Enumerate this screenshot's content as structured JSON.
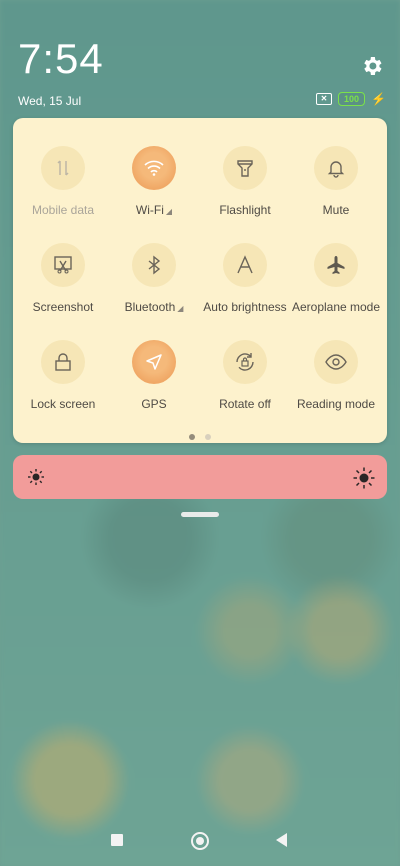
{
  "status": {
    "time": "7:54",
    "date": "Wed, 15 Jul",
    "battery": "100",
    "sim_icon_label": "✕"
  },
  "tiles": [
    {
      "label": "Mobile data",
      "icon": "mobile-data-icon",
      "active": false,
      "disabled": true
    },
    {
      "label": "Wi-Fi",
      "icon": "wifi-icon",
      "active": true,
      "expandable": true
    },
    {
      "label": "Flashlight",
      "icon": "flashlight-icon",
      "active": false
    },
    {
      "label": "Mute",
      "icon": "bell-icon",
      "active": false
    },
    {
      "label": "Screenshot",
      "icon": "screenshot-icon",
      "active": false
    },
    {
      "label": "Bluetooth",
      "icon": "bluetooth-icon",
      "active": false,
      "expandable": true
    },
    {
      "label": "Auto brightness",
      "icon": "auto-brightness-icon",
      "active": false
    },
    {
      "label": "Aeroplane mode",
      "icon": "airplane-icon",
      "active": false
    },
    {
      "label": "Lock screen",
      "icon": "lock-icon",
      "active": false
    },
    {
      "label": "GPS",
      "icon": "location-arrow-icon",
      "active": true
    },
    {
      "label": "Rotate off",
      "icon": "rotate-lock-icon",
      "active": false
    },
    {
      "label": "Reading mode",
      "icon": "eye-icon",
      "active": false
    }
  ],
  "pager": {
    "pages": 2,
    "current": 1
  },
  "brightness": {
    "color": "#f29c9a"
  },
  "colors": {
    "panel": "#fdf2cd",
    "active_tile": "#f0a866",
    "battery": "#7be24a"
  },
  "nav": {
    "icons": [
      "recents-icon",
      "home-icon",
      "back-icon"
    ]
  }
}
